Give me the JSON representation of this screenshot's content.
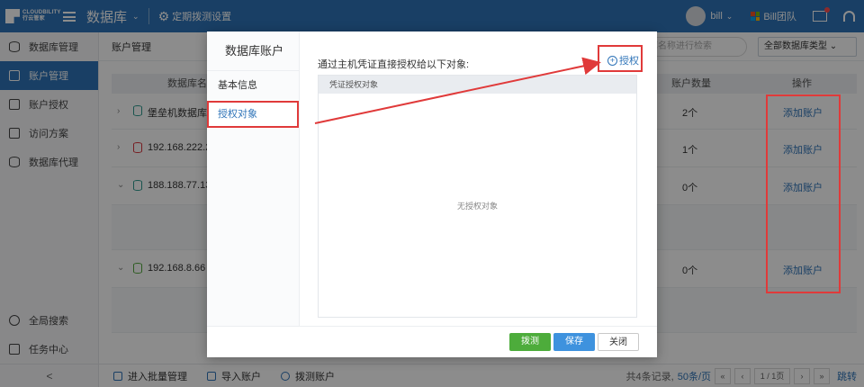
{
  "topbar": {
    "logo_text_1": "CLOUDBILITY",
    "logo_text_2": "行云管家",
    "app_title": "数据库",
    "schedule_label": "定期拨测设置",
    "user": "bill",
    "team": "Bill团队"
  },
  "sidebar": {
    "items": [
      {
        "label": "数据库管理"
      },
      {
        "label": "账户管理"
      },
      {
        "label": "账户授权"
      },
      {
        "label": "访问方案"
      },
      {
        "label": "数据库代理"
      }
    ],
    "global_search": "全局搜索",
    "task_center": "任务中心",
    "collapse": "<"
  },
  "main": {
    "breadcrumb": "账户管理",
    "search_placeholder": "按数据库名称进行检索",
    "filter_label": "全部数据库类型",
    "columns": {
      "name": "数据库名称",
      "count": "账户数量",
      "ops": "操作"
    },
    "rows": [
      {
        "name": "堡垒机数据库",
        "count": "2个",
        "action": "添加账户"
      },
      {
        "name": "192.168.222.2",
        "count": "1个",
        "action": "添加账户"
      },
      {
        "name": "188.188.77.138",
        "count": "0个",
        "action": "添加账户"
      },
      {
        "name": "192.168.8.66",
        "count": "0个",
        "action": "添加账户"
      }
    ]
  },
  "footer": {
    "bulk_manage": "进入批量管理",
    "import_accounts": "导入账户",
    "probe_accounts": "拨测账户",
    "total": "共4条记录,",
    "per_page": "50条/页",
    "page_info": "1 / 1页",
    "jump": "跳转"
  },
  "dialog": {
    "title": "数据库账户",
    "nav_basic": "基本信息",
    "nav_grant": "授权对象",
    "description": "通过主机凭证直接授权给以下对象:",
    "grant_button": "授权",
    "table_header": "凭证授权对象",
    "empty_text": "无授权对象",
    "btn_probe": "拨测",
    "btn_save": "保存",
    "btn_close": "关闭"
  }
}
